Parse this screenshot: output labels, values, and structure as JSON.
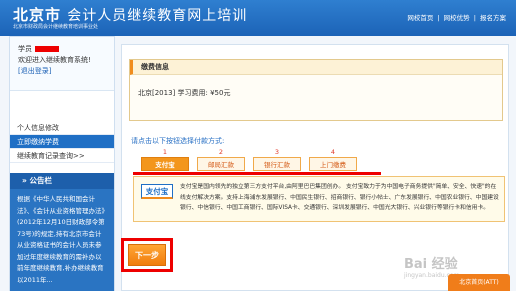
{
  "header": {
    "logo_main": "北京市",
    "logo_sub": "会计人员继续教育网上培训",
    "subtitle": "北京市财政局会计继续教育培训事业处",
    "nav": [
      "网校首页",
      "网校优势",
      "报名方案"
    ]
  },
  "sidebar": {
    "student_label": "学员",
    "welcome": "欢迎进入继续教育系统!",
    "logout": "[退出登录]",
    "menu": [
      "个人信息修改",
      "立即缴纳学费",
      "继续教育记录查询>>"
    ],
    "bulletin_title": "» 公告栏",
    "bulletin_text": "根据《中华人民共和国会计法》、《会计从业资格管理办法》(2012年12月10日财政部令第73号)的规定,持有北京市会计从业资格证书的会计人员未参加过年度继续教育的需补办以前年度继续教育,补办继续教育以2011年..."
  },
  "fee": {
    "title": "缴费信息",
    "detail": "北京[2013] 学习费用: ¥50元"
  },
  "payment": {
    "prompt": "请点击以下按钮选择付款方式:",
    "tabs": [
      {
        "num": "1",
        "label": "支付宝"
      },
      {
        "num": "2",
        "label": "邮局汇款"
      },
      {
        "num": "3",
        "label": "银行汇款"
      },
      {
        "num": "4",
        "label": "上门缴费"
      }
    ],
    "logo_text": "支付宝",
    "description": "支付宝是国内领先的独立第三方支付平台,由阿里巴巴集团创办。 支付宝致力于为中国电子商务提供\"简单、安全、快速\"的在线支付解决方案。支持上海浦东发展银行、中国民生银行、招商银行、银行小帖士、广东发展银行、中国农业银行、中国建设银行、中信银行、中国工商银行、国际VISA卡、交通银行、深圳发展银行、中国光大银行、兴业银行等银行卡和信用卡。"
  },
  "actions": {
    "next": "下一步",
    "corner_tab": "北京首页(ATT)"
  },
  "watermark": {
    "main": "Bai 经验",
    "sub": "jingyan.baidu.com"
  },
  "colors": {
    "header_blue": "#1c63b7",
    "accent_orange": "#f3961c",
    "highlight_red": "#e00000"
  }
}
